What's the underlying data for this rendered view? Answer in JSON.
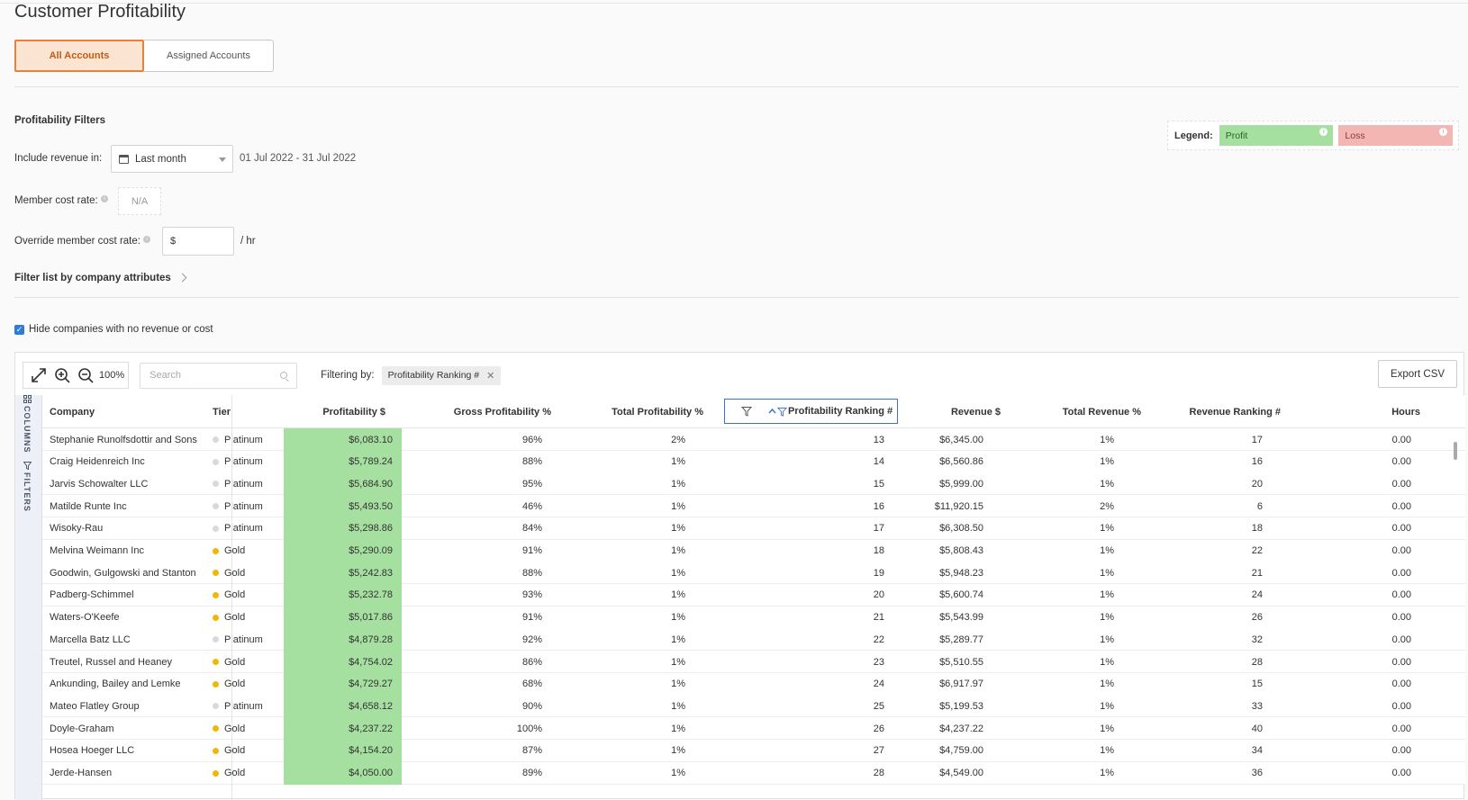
{
  "page": {
    "title": "Customer Profitability"
  },
  "tabs": [
    {
      "label": "All Accounts",
      "active": true
    },
    {
      "label": "Assigned Accounts",
      "active": false
    }
  ],
  "filters": {
    "heading": "Profitability Filters",
    "include_revenue_label": "Include revenue in:",
    "revenue_period": "Last month",
    "date_range": "01 Jul 2022 - 31 Jul 2022",
    "member_cost_label": "Member cost rate:",
    "member_cost_value": "N/A",
    "override_label": "Override member cost rate:",
    "override_value": "$",
    "override_unit": "/ hr",
    "company_attrs_label": "Filter list by company attributes"
  },
  "legend": {
    "title": "Legend:",
    "profit_label": "Profit",
    "loss_label": "Loss",
    "profit_color": "#a6e0a0",
    "loss_color": "#f4b6b3"
  },
  "hide_companies": {
    "label": "Hide companies with no revenue or cost",
    "checked": true
  },
  "toolbar": {
    "zoom": "100%",
    "search_placeholder": "Search",
    "filtering_label": "Filtering by:",
    "filter_chip": "Profitability Ranking #",
    "export_label": "Export CSV"
  },
  "side_tabs": {
    "columns": "COLUMNS",
    "filters": "FILTERS"
  },
  "table": {
    "columns": [
      "Company",
      "Tier",
      "Profitability $",
      "Gross Profitability %",
      "Total Profitability %",
      "Profitability Ranking #",
      "Revenue $",
      "Total Revenue %",
      "Revenue Ranking #",
      "Hours"
    ],
    "tier_colors": {
      "Platinum": "#d9d9d9",
      "Gold": "#f2b705"
    },
    "rows": [
      [
        "Stephanie Runolfsdottir and Sons",
        "Platinum",
        "$6,083.10",
        "96%",
        "2%",
        "13",
        "$6,345.00",
        "1%",
        "17",
        "0.00"
      ],
      [
        "Craig Heidenreich Inc",
        "Platinum",
        "$5,789.24",
        "88%",
        "1%",
        "14",
        "$6,560.86",
        "1%",
        "16",
        "0.00"
      ],
      [
        "Jarvis Schowalter LLC",
        "Platinum",
        "$5,684.90",
        "95%",
        "1%",
        "15",
        "$5,999.00",
        "1%",
        "20",
        "0.00"
      ],
      [
        "Matilde Runte Inc",
        "Platinum",
        "$5,493.50",
        "46%",
        "1%",
        "16",
        "$11,920.15",
        "2%",
        "6",
        "0.00"
      ],
      [
        "Wisoky-Rau",
        "Platinum",
        "$5,298.86",
        "84%",
        "1%",
        "17",
        "$6,308.50",
        "1%",
        "18",
        "0.00"
      ],
      [
        "Melvina Weimann Inc",
        "Gold",
        "$5,290.09",
        "91%",
        "1%",
        "18",
        "$5,808.43",
        "1%",
        "22",
        "0.00"
      ],
      [
        "Goodwin, Gulgowski and Stanton",
        "Gold",
        "$5,242.83",
        "88%",
        "1%",
        "19",
        "$5,948.23",
        "1%",
        "21",
        "0.00"
      ],
      [
        "Padberg-Schimmel",
        "Gold",
        "$5,232.78",
        "93%",
        "1%",
        "20",
        "$5,600.74",
        "1%",
        "24",
        "0.00"
      ],
      [
        "Waters-O'Keefe",
        "Gold",
        "$5,017.86",
        "91%",
        "1%",
        "21",
        "$5,543.99",
        "1%",
        "26",
        "0.00"
      ],
      [
        "Marcella Batz LLC",
        "Platinum",
        "$4,879.28",
        "92%",
        "1%",
        "22",
        "$5,289.77",
        "1%",
        "32",
        "0.00"
      ],
      [
        "Treutel, Russel and Heaney",
        "Gold",
        "$4,754.02",
        "86%",
        "1%",
        "23",
        "$5,510.55",
        "1%",
        "28",
        "0.00"
      ],
      [
        "Ankunding, Bailey and Lemke",
        "Gold",
        "$4,729.27",
        "68%",
        "1%",
        "24",
        "$6,917.97",
        "1%",
        "15",
        "0.00"
      ],
      [
        "Mateo Flatley Group",
        "Platinum",
        "$4,658.12",
        "90%",
        "1%",
        "25",
        "$5,199.53",
        "1%",
        "33",
        "0.00"
      ],
      [
        "Doyle-Graham",
        "Gold",
        "$4,237.22",
        "100%",
        "1%",
        "26",
        "$4,237.22",
        "1%",
        "40",
        "0.00"
      ],
      [
        "Hosea Hoeger LLC",
        "Gold",
        "$4,154.20",
        "87%",
        "1%",
        "27",
        "$4,759.00",
        "1%",
        "34",
        "0.00"
      ],
      [
        "Jerde-Hansen",
        "Gold",
        "$4,050.00",
        "89%",
        "1%",
        "28",
        "$4,549.00",
        "1%",
        "36",
        "0.00"
      ]
    ]
  }
}
